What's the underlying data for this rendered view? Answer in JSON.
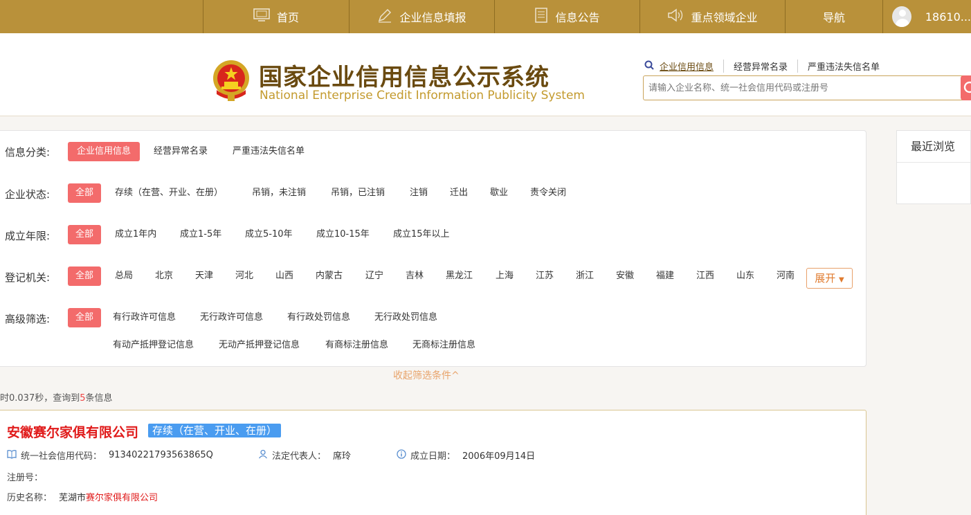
{
  "nav": {
    "items": [
      {
        "label": "首页",
        "icon": "monitor-icon"
      },
      {
        "label": "企业信息填报",
        "icon": "edit-icon"
      },
      {
        "label": "信息公告",
        "icon": "document-icon"
      },
      {
        "label": "重点领域企业",
        "icon": "speaker-icon"
      },
      {
        "label": "导航",
        "icon": ""
      }
    ],
    "user": "18610..."
  },
  "header": {
    "title": "国家企业信用信息公示系统",
    "subtitle": "National Enterprise Credit Information Publicity System",
    "search_links": [
      "企业信用信息",
      "经营异常名录",
      "严重违法失信名单"
    ],
    "search_placeholder": "请输入企业名称、统一社会信用代码或注册号"
  },
  "filters": {
    "category": {
      "label": "信息分类:",
      "options": [
        "企业信用信息",
        "经营异常名录",
        "严重违法失信名单"
      ]
    },
    "status": {
      "label": "企业状态:",
      "options": [
        "全部",
        "存续（在营、开业、在册）",
        "吊销，未注销",
        "吊销，已注销",
        "注销",
        "迁出",
        "歇业",
        "责令关闭"
      ]
    },
    "years": {
      "label": "成立年限:",
      "options": [
        "全部",
        "成立1年内",
        "成立1-5年",
        "成立5-10年",
        "成立10-15年",
        "成立15年以上"
      ]
    },
    "authority": {
      "label": "登记机关:",
      "options": [
        "全部",
        "总局",
        "北京",
        "天津",
        "河北",
        "山西",
        "内蒙古",
        "辽宁",
        "吉林",
        "黑龙江",
        "上海",
        "江苏",
        "浙江",
        "安徽",
        "福建",
        "江西",
        "山东",
        "河南"
      ],
      "expand": "展开"
    },
    "advanced": {
      "label": "高级筛选:",
      "options": [
        "全部",
        "有行政许可信息",
        "无行政许可信息",
        "有行政处罚信息",
        "无行政处罚信息",
        "有动产抵押登记信息",
        "无动产抵押登记信息",
        "有商标注册信息",
        "无商标注册信息"
      ]
    },
    "collapse": "收起筛选条件^"
  },
  "recent": {
    "title": "最近浏览"
  },
  "stats": {
    "prefix": "时0.037秒，查询到",
    "count": "5",
    "suffix": "条信息"
  },
  "result": {
    "name": "安徽赛尔家俱有限公司",
    "status": "存续（在营、开业、在册）",
    "credit_code_label": "统一社会信用代码：",
    "credit_code": "91340221793563865Q",
    "legal_rep_label": "法定代表人：",
    "legal_rep": "席玲",
    "founded_label": "成立日期：",
    "founded": "2006年09月14日",
    "reg_no_label": "注册号：",
    "history_label": "历史名称：",
    "history_prefix": "芜湖市",
    "history_highlight": "赛尔家俱有限公司"
  }
}
